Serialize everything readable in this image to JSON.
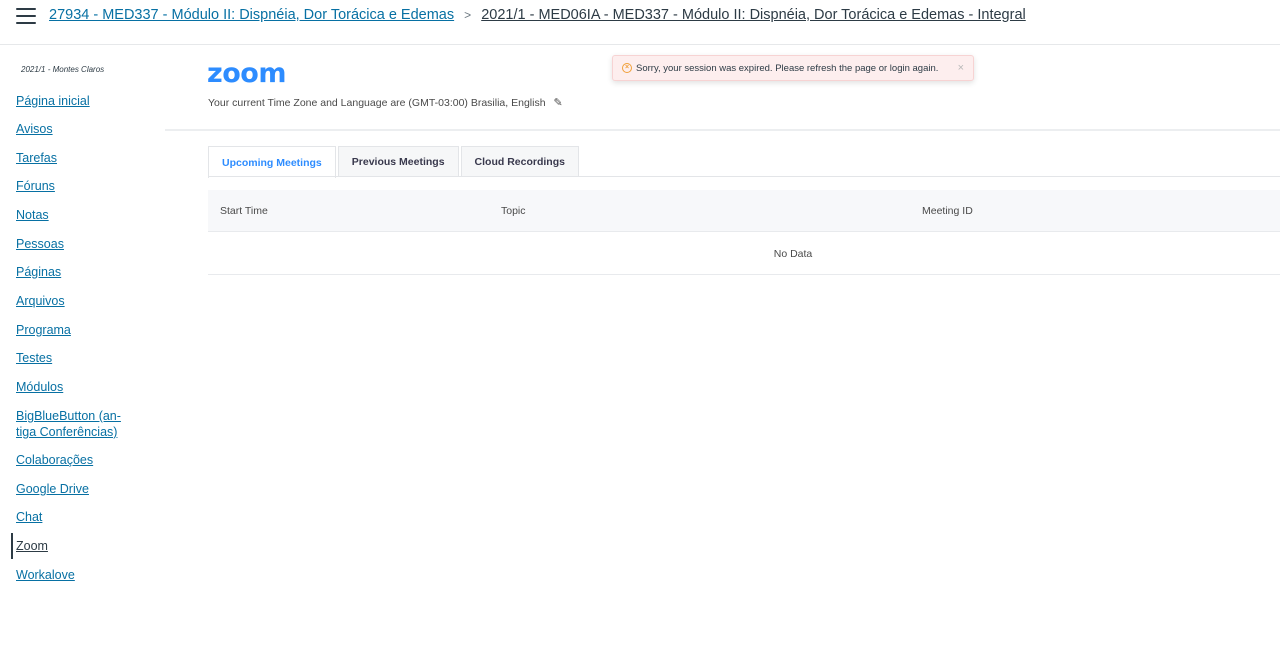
{
  "header": {
    "breadcrumb": [
      {
        "label": "27934 - MED337 - Módulo II: Dispnéia, Dor Torácica e Edemas"
      },
      {
        "label": "2021/1 - MED06IA - MED337 - Módulo II: Dispnéia, Dor Torácica e Edemas - Integral"
      }
    ],
    "separator": ">"
  },
  "sidebar": {
    "term": "2021/1 - Montes Claros",
    "items": [
      {
        "label": "Página inicial"
      },
      {
        "label": "Avisos"
      },
      {
        "label": "Tarefas"
      },
      {
        "label": "Fóruns"
      },
      {
        "label": "Notas"
      },
      {
        "label": "Pessoas"
      },
      {
        "label": "Páginas"
      },
      {
        "label": "Arquivos"
      },
      {
        "label": "Programa"
      },
      {
        "label": "Testes"
      },
      {
        "label": "Módulos"
      },
      {
        "label": "BigBlueButton (an-",
        "label2": "tiga Conferências)"
      },
      {
        "label": "Colaborações"
      },
      {
        "label": "Google Drive"
      },
      {
        "label": "Chat"
      },
      {
        "label": "Zoom"
      },
      {
        "label": "Workalove"
      }
    ],
    "active_index": 15
  },
  "main": {
    "logo_text": "zoom",
    "timezone_text": "Your current Time Zone and Language are (GMT-03:00) Brasilia, English",
    "tabs": [
      {
        "label": "Upcoming Meetings"
      },
      {
        "label": "Previous Meetings"
      },
      {
        "label": "Cloud Recordings"
      }
    ],
    "active_tab": 0,
    "table": {
      "columns": [
        "Start Time",
        "Topic",
        "Meeting ID"
      ],
      "empty_text": "No Data"
    }
  },
  "toast": {
    "message": "Sorry, your session was expired. Please refresh the page or login again.",
    "close_symbol": "×"
  },
  "colors": {
    "link": "#0770a3",
    "zoom_blue": "#2d8cff",
    "toast_bg": "#fdeeee"
  }
}
